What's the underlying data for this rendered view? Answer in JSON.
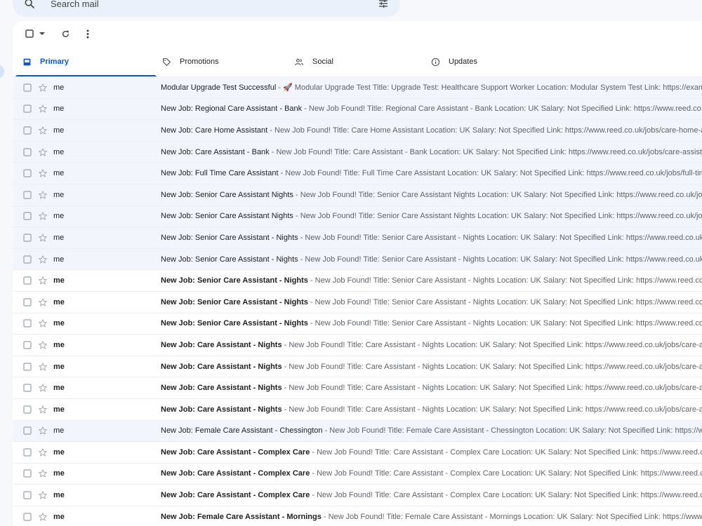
{
  "search": {
    "placeholder": "Search mail"
  },
  "icons": {
    "search": "search-icon",
    "tune": "tune-icon",
    "checkbox": "checkbox-icon",
    "caret": "caret-down-icon",
    "refresh": "refresh-icon",
    "more": "more-vert-icon",
    "star": "star-icon"
  },
  "colors": {
    "accent": "#0b57d0",
    "background": "#f6f8fc",
    "search_bg": "#eaf1fb",
    "read_row": "#f2f6fc"
  },
  "tabs": [
    {
      "label": "Primary",
      "icon": "inbox-icon",
      "selected": true
    },
    {
      "label": "Promotions",
      "icon": "tag-icon"
    },
    {
      "label": "Social",
      "icon": "people-icon"
    },
    {
      "label": "Updates",
      "icon": "info-icon"
    }
  ],
  "emails": [
    {
      "sender": "me",
      "subject": "Modular Upgrade Test Successful",
      "snippet": " - 🚀 Modular Upgrade Test Title: Upgrade Test: Healthcare Support Worker Location: Modular System Test Link: https://example",
      "unread": false
    },
    {
      "sender": "me",
      "subject": "New Job: Regional Care Assistant - Bank",
      "snippet": " - New Job Found! Title: Regional Care Assistant - Bank Location: UK Salary: Not Specified Link: https://www.reed.co.uk/jobs/",
      "unread": false
    },
    {
      "sender": "me",
      "subject": "New Job: Care Home Assistant",
      "snippet": " - New Job Found! Title: Care Home Assistant Location: UK Salary: Not Specified Link: https://www.reed.co.uk/jobs/care-home-assistant",
      "unread": false
    },
    {
      "sender": "me",
      "subject": "New Job: Care Assistant - Bank",
      "snippet": " - New Job Found! Title: Care Assistant - Bank Location: UK Salary: Not Specified Link: https://www.reed.co.uk/jobs/care-assistant",
      "unread": false
    },
    {
      "sender": "me",
      "subject": "New Job: Full Time Care Assistant",
      "snippet": " - New Job Found! Title: Full Time Care Assistant Location: UK Salary: Not Specified Link: https://www.reed.co.uk/jobs/full-time",
      "unread": false
    },
    {
      "sender": "me",
      "subject": "New Job: Senior Care Assistant Nights",
      "snippet": " - New Job Found! Title: Senior Care Assistant Nights Location: UK Salary: Not Specified Link: https://www.reed.co.uk/jobs/",
      "unread": false
    },
    {
      "sender": "me",
      "subject": "New Job: Senior Care Assistant Nights",
      "snippet": " - New Job Found! Title: Senior Care Assistant Nights Location: UK Salary: Not Specified Link: https://www.reed.co.uk/jobs/",
      "unread": false
    },
    {
      "sender": "me",
      "subject": "New Job: Senior Care Assistant - Nights",
      "snippet": " - New Job Found! Title: Senior Care Assistant - Nights Location: UK Salary: Not Specified Link: https://www.reed.co.uk/jobs/",
      "unread": false
    },
    {
      "sender": "me",
      "subject": "New Job: Senior Care Assistant - Nights",
      "snippet": " - New Job Found! Title: Senior Care Assistant - Nights Location: UK Salary: Not Specified Link: https://www.reed.co.uk/jobs/",
      "unread": false
    },
    {
      "sender": "me",
      "subject": "New Job: Senior Care Assistant - Nights",
      "snippet": " - New Job Found! Title: Senior Care Assistant - Nights Location: UK Salary: Not Specified Link: https://www.reed.co.uk/jobs/",
      "unread": true
    },
    {
      "sender": "me",
      "subject": "New Job: Senior Care Assistant - Nights",
      "snippet": " - New Job Found! Title: Senior Care Assistant - Nights Location: UK Salary: Not Specified Link: https://www.reed.co.uk/jobs/",
      "unread": true
    },
    {
      "sender": "me",
      "subject": "New Job: Senior Care Assistant - Nights",
      "snippet": " - New Job Found! Title: Senior Care Assistant - Nights Location: UK Salary: Not Specified Link: https://www.reed.co.uk/jobs/",
      "unread": true
    },
    {
      "sender": "me",
      "subject": "New Job: Care Assistant - Nights",
      "snippet": " - New Job Found! Title: Care Assistant - Nights Location: UK Salary: Not Specified Link: https://www.reed.co.uk/jobs/care-assistant",
      "unread": true
    },
    {
      "sender": "me",
      "subject": "New Job: Care Assistant - Nights",
      "snippet": " - New Job Found! Title: Care Assistant - Nights Location: UK Salary: Not Specified Link: https://www.reed.co.uk/jobs/care-assistant",
      "unread": true
    },
    {
      "sender": "me",
      "subject": "New Job: Care Assistant - Nights",
      "snippet": " - New Job Found! Title: Care Assistant - Nights Location: UK Salary: Not Specified Link: https://www.reed.co.uk/jobs/care-assistant",
      "unread": true
    },
    {
      "sender": "me",
      "subject": "New Job: Care Assistant - Nights",
      "snippet": " - New Job Found! Title: Care Assistant - Nights Location: UK Salary: Not Specified Link: https://www.reed.co.uk/jobs/care-assistant",
      "unread": true
    },
    {
      "sender": "me",
      "subject": "New Job: Female Care Assistant - Chessington",
      "snippet": " - New Job Found! Title: Female Care Assistant - Chessington Location: UK Salary: Not Specified Link: https://www.reed.co.uk/jobs/",
      "unread": false
    },
    {
      "sender": "me",
      "subject": "New Job: Care Assistant - Complex Care",
      "snippet": " - New Job Found! Title: Care Assistant - Complex Care Location: UK Salary: Not Specified Link: https://www.reed.co.uk/jobs/",
      "unread": true
    },
    {
      "sender": "me",
      "subject": "New Job: Care Assistant - Complex Care",
      "snippet": " - New Job Found! Title: Care Assistant - Complex Care Location: UK Salary: Not Specified Link: https://www.reed.co.uk/jobs/",
      "unread": true
    },
    {
      "sender": "me",
      "subject": "New Job: Care Assistant - Complex Care",
      "snippet": " - New Job Found! Title: Care Assistant - Complex Care Location: UK Salary: Not Specified Link: https://www.reed.co.uk/jobs/",
      "unread": true
    },
    {
      "sender": "me",
      "subject": "New Job: Female Care Assistant - Mornings",
      "snippet": " - New Job Found! Title: Female Care Assistant - Mornings Location: UK Salary: Not Specified Link: https://www.reed.co.uk/jobs/",
      "unread": true
    }
  ]
}
